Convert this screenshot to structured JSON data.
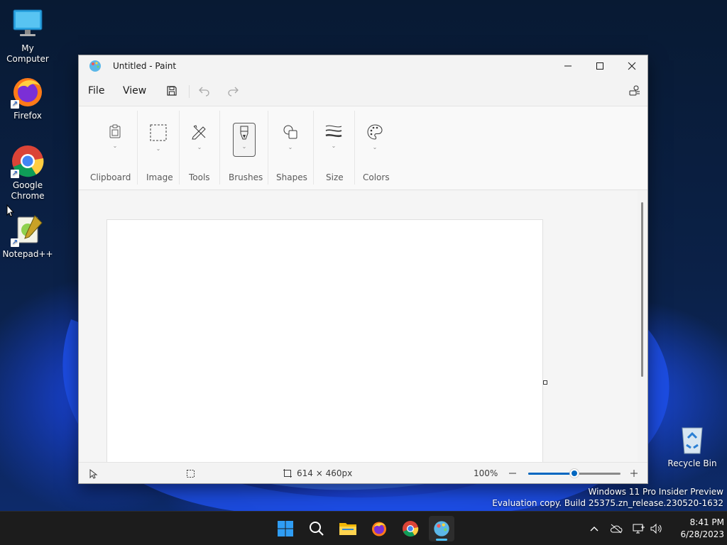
{
  "desktop": {
    "icons": [
      {
        "label": "My Computer"
      },
      {
        "label": "Firefox"
      },
      {
        "label": "Google Chrome"
      },
      {
        "label": "Notepad++"
      },
      {
        "label": "Recycle Bin"
      }
    ],
    "watermark": {
      "line1": "Windows 11 Pro Insider Preview",
      "line2": "Evaluation copy. Build 25375.zn_release.230520-1632"
    }
  },
  "window": {
    "title": "Untitled - Paint",
    "menu": [
      "File",
      "View"
    ],
    "ribbon": {
      "groups": [
        {
          "label": "Clipboard",
          "icon": "clipboard-icon"
        },
        {
          "label": "Image",
          "icon": "selection-icon"
        },
        {
          "label": "Tools",
          "icon": "pencil-tools-icon"
        },
        {
          "label": "Brushes",
          "icon": "brush-icon"
        },
        {
          "label": "Shapes",
          "icon": "shapes-icon"
        },
        {
          "label": "Size",
          "icon": "line-size-icon"
        },
        {
          "label": "Colors",
          "icon": "palette-icon"
        }
      ]
    },
    "status": {
      "canvas_size": "614 × 460px",
      "zoom": "100%",
      "zoom_level": 0.5
    }
  },
  "taskbar": {
    "time": "8:41 PM",
    "date": "6/28/2023"
  },
  "colors": {
    "accent": "#0067c0",
    "taskbar": "#1c1c1c"
  }
}
